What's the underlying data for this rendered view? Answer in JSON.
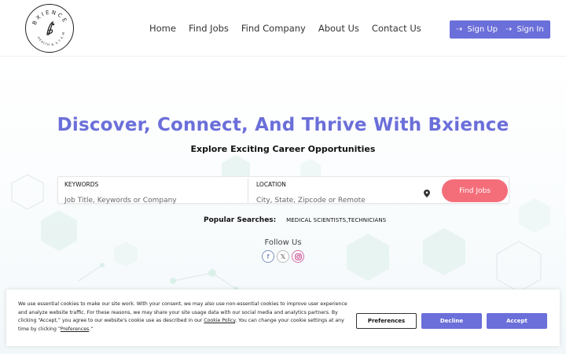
{
  "header": {
    "logo_text_top": "BXIENCE",
    "logo_text_bottom": "HEALTH & S.T.E.M",
    "nav": [
      "Home",
      "Find Jobs",
      "Find Company",
      "About Us",
      "Contact Us"
    ],
    "signup_label": "Sign Up",
    "signin_label": "Sign In"
  },
  "hero": {
    "title": "Discover, Connect, And Thrive With Bxience",
    "subtitle": "Explore Exciting Career Opportunities"
  },
  "search": {
    "keywords_label": "KEYWORDS",
    "keywords_placeholder": "Job Title, Keywords or Company",
    "location_label": "LOCATION",
    "location_placeholder": "City, State, Zipcode or Remote",
    "button_label": "Find Jobs"
  },
  "popular": {
    "label": "Popular Searches:",
    "tags": "MEDICAL SCIENTISTS,TECHNICIANS"
  },
  "follow": {
    "label": "Follow Us",
    "icons": [
      "facebook-icon",
      "x-icon",
      "instagram-icon"
    ]
  },
  "cookie": {
    "text_1": "We use essential cookies to make our site work. With your consent, we may also use non-essential cookies to improve user experience and analyze website traffic. For these reasons, we may share your site usage data with our social media and analytics partners. By clicking “Accept,” you agree to our website's cookie use as described in our ",
    "policy_link": "Cookie Policy",
    "text_2": ". You can change your cookie settings at any time by clicking “",
    "prefs_link": "Preferences",
    "text_3": ".”",
    "preferences_label": "Preferences",
    "decline_label": "Decline",
    "accept_label": "Accept"
  },
  "colors": {
    "brand": "#6b6fd9",
    "find_button": "#f46e7a"
  }
}
